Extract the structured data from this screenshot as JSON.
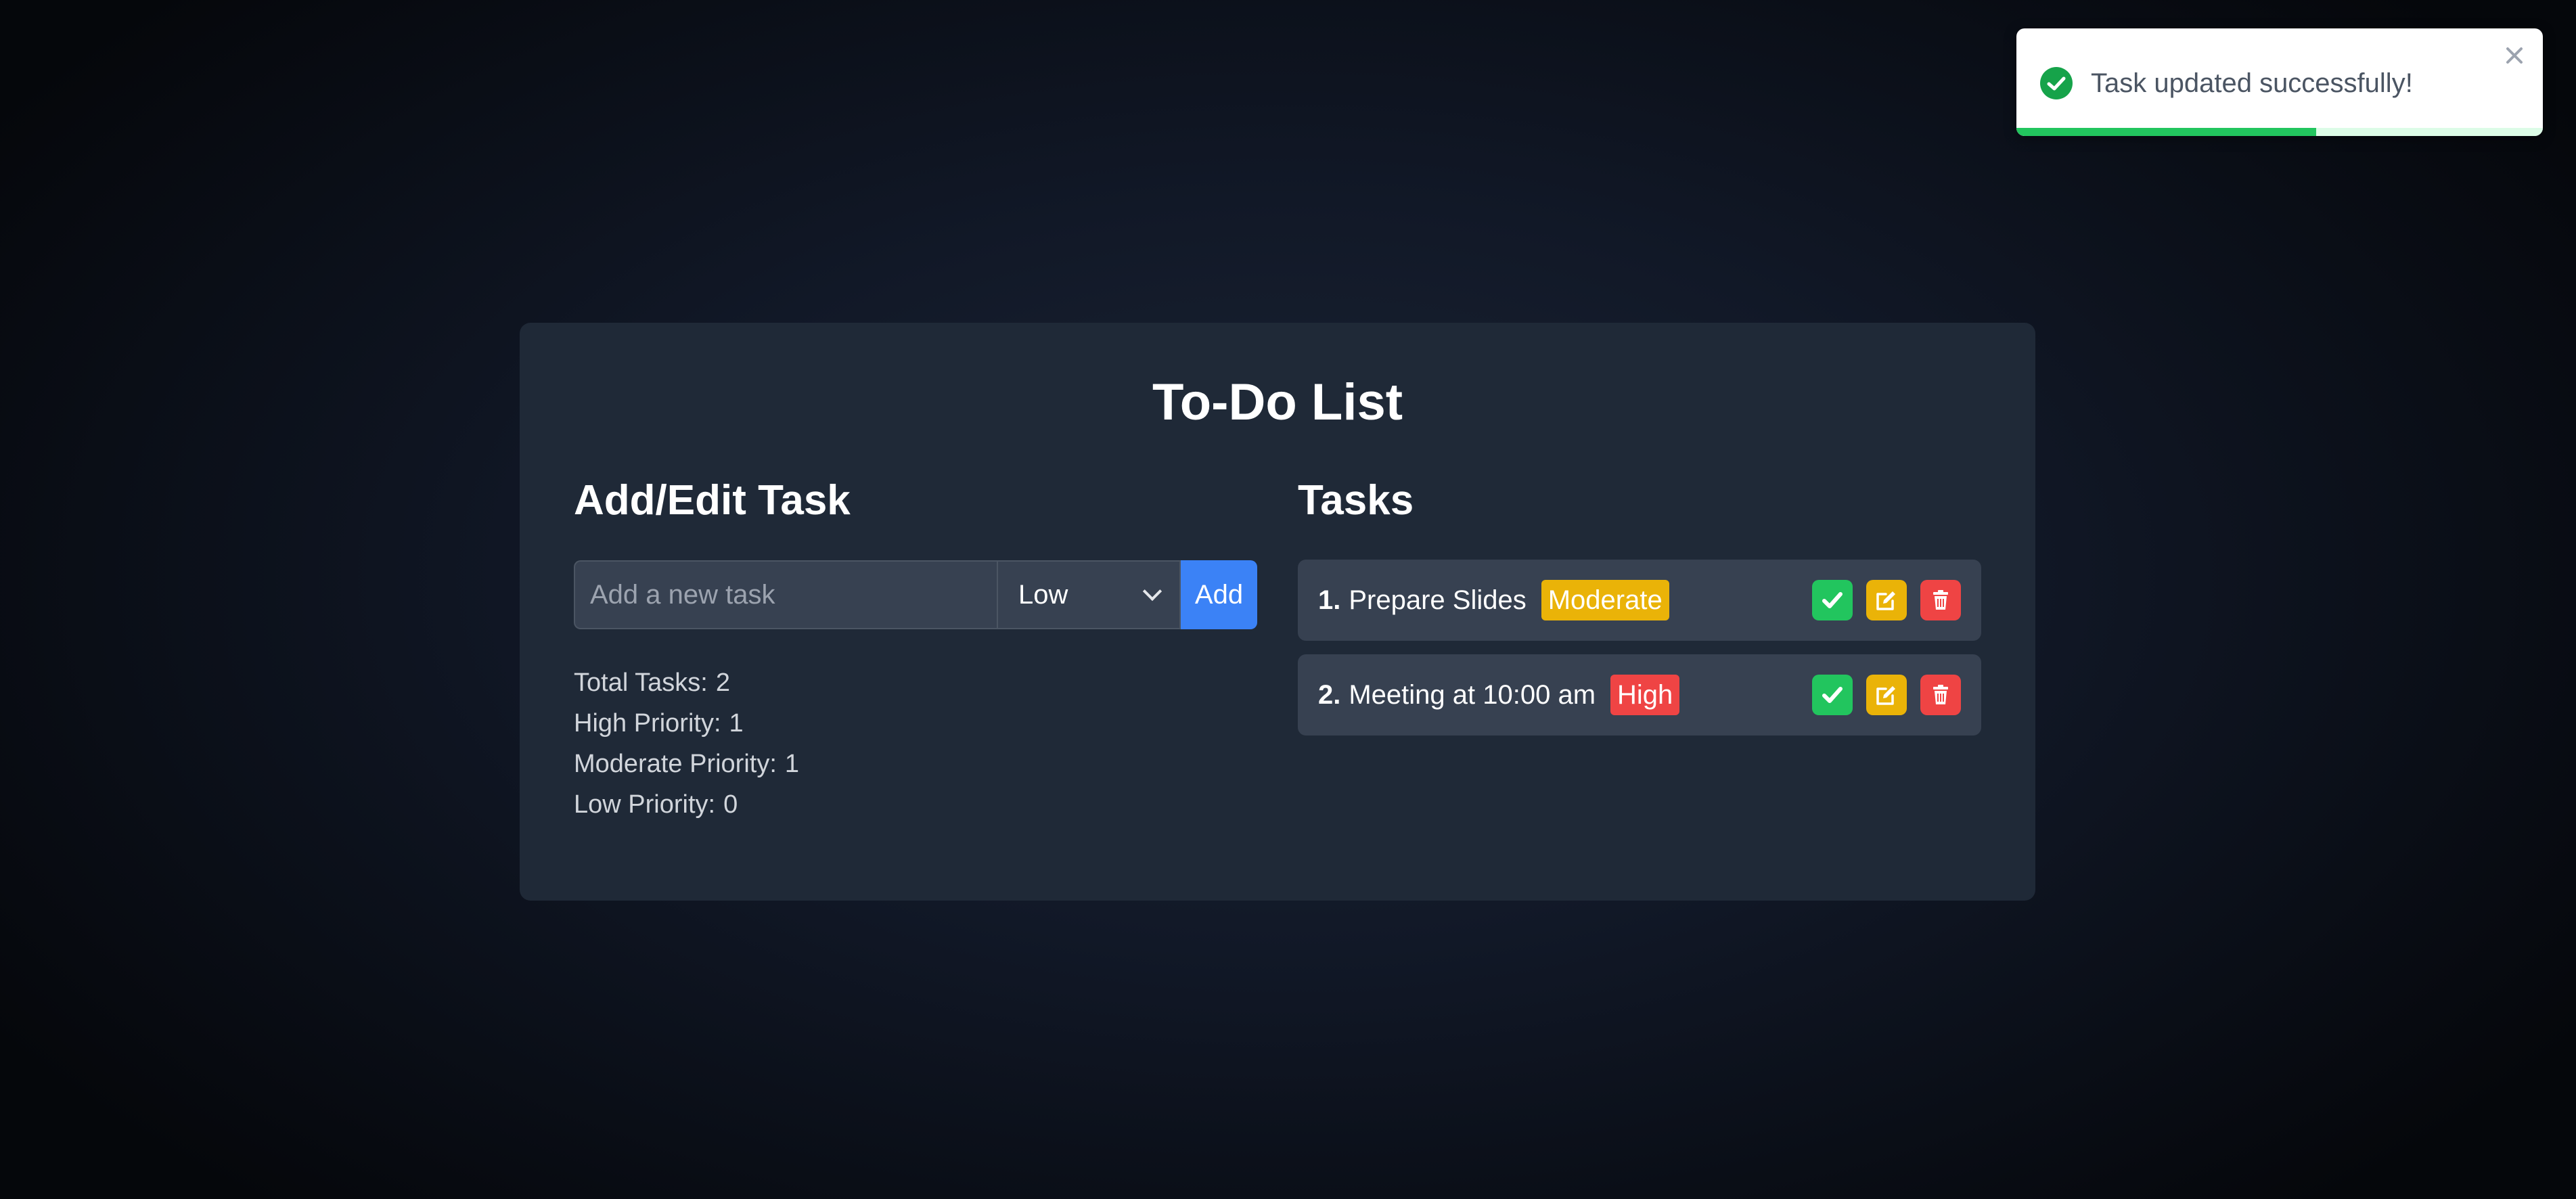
{
  "page": {
    "title": "To-Do List"
  },
  "form": {
    "heading": "Add/Edit Task",
    "input_placeholder": "Add a new task",
    "input_value": "",
    "priority_selected": "Low",
    "add_label": "Add"
  },
  "stats": {
    "total": {
      "label": "Total Tasks:",
      "value": "2"
    },
    "high": {
      "label": "High Priority:",
      "value": "1"
    },
    "moderate": {
      "label": "Moderate Priority:",
      "value": "1"
    },
    "low": {
      "label": "Low Priority:",
      "value": "0"
    }
  },
  "tasks": {
    "heading": "Tasks",
    "items": [
      {
        "number": "1.",
        "text": "Prepare Slides",
        "priority": "Moderate"
      },
      {
        "number": "2.",
        "text": "Meeting at 10:00 am",
        "priority": "High"
      }
    ]
  },
  "toast": {
    "message": "Task updated successfully!",
    "progress": 0.57
  },
  "colors": {
    "complete": "#22c55e",
    "edit": "#eab308",
    "delete": "#ef4444",
    "add": "#3b82f6",
    "badge_moderate": "#eab308",
    "badge_high": "#ef4444"
  },
  "icons": {
    "complete": "check-icon",
    "edit": "edit-icon",
    "delete": "trash-icon",
    "toast": "check-circle-icon",
    "close": "close-icon"
  }
}
